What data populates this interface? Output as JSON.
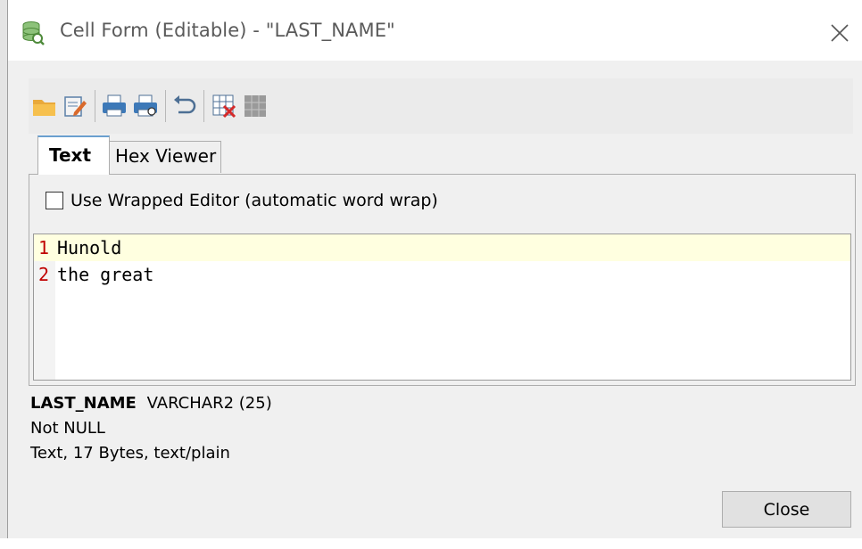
{
  "window": {
    "title": "Cell Form (Editable) - \"LAST_NAME\"",
    "close_icon": "close-icon"
  },
  "toolbar": {
    "buttons": [
      {
        "name": "open-folder-icon"
      },
      {
        "name": "edit-icon"
      },
      {
        "name": "print-icon"
      },
      {
        "name": "print-preview-icon"
      },
      {
        "name": "undo-icon"
      },
      {
        "name": "clear-grid-icon"
      },
      {
        "name": "grid-icon",
        "disabled": true
      }
    ]
  },
  "tabs": [
    {
      "label": "Text",
      "active": true
    },
    {
      "label": "Hex Viewer",
      "active": false
    }
  ],
  "text_tab": {
    "wrap_label": "Use Wrapped Editor (automatic word wrap)",
    "wrap_checked": false,
    "lines": [
      {
        "number": "1",
        "text": "Hunold"
      },
      {
        "number": "2",
        "text": "the great"
      }
    ]
  },
  "info": {
    "column_name": "LAST_NAME",
    "column_type": "VARCHAR2 (25)",
    "nullability": "Not NULL",
    "content_info": "Text, 17 Bytes, text/plain"
  },
  "buttons": {
    "close_label": "Close"
  },
  "colors": {
    "accent": "#6a9fcf",
    "current_line": "#ffffe0",
    "line_number": "#c00000"
  }
}
